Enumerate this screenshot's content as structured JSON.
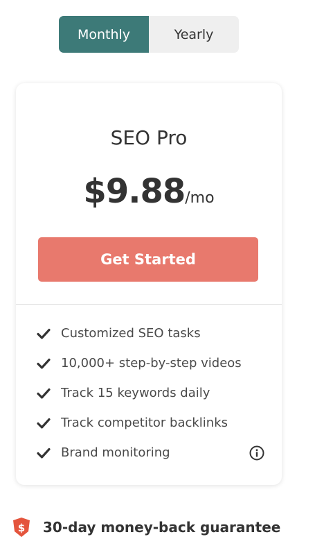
{
  "billing_toggle": {
    "monthly_label": "Monthly",
    "yearly_label": "Yearly",
    "active": "Monthly"
  },
  "plan": {
    "name": "SEO Pro",
    "price": "$9.88",
    "period": "/mo",
    "cta_label": "Get Started",
    "features": [
      {
        "label": "Customized SEO tasks",
        "icon": "checkmark-icon"
      },
      {
        "label": "10,000+ step-by-step videos",
        "icon": "checkmark-icon"
      },
      {
        "label": "Track 15 keywords daily",
        "icon": "checkmark-icon"
      },
      {
        "label": "Track competitor backlinks",
        "icon": "checkmark-icon"
      },
      {
        "label": "Brand monitoring",
        "icon": "checkmark-icon",
        "has_info": true
      }
    ]
  },
  "guarantee": {
    "text": "30-day money-back guarantee",
    "icon": "dollar-shield-icon",
    "icon_glyph": "$"
  },
  "colors": {
    "toggle_active": "#3d7a78",
    "cta": "#e8796d",
    "shield": "#e4553d"
  }
}
